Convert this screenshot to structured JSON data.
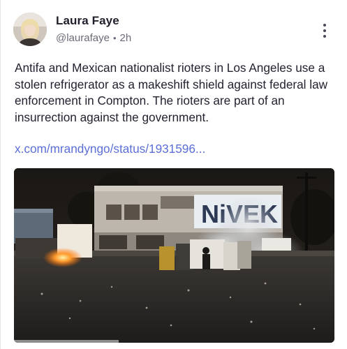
{
  "post": {
    "author_name": "Laura Faye",
    "handle": "@laurafaye",
    "separator": "•",
    "time": "2h",
    "more_icon": "vertical-ellipsis-icon",
    "text": "Antifa and Mexican nationalist rioters in Los Angeles use a stolen refrigerator as a makeshift shield against federal law enforcement in Compton. The rioters are part of an insurrection against the government.",
    "link_text": "x.com/mrandyngo/status/1931596...",
    "media": {
      "sign_text": "NiVEK"
    }
  },
  "colors": {
    "link": "#5b6fd8",
    "author": "#1f1f2b",
    "meta": "#6b6b78"
  }
}
